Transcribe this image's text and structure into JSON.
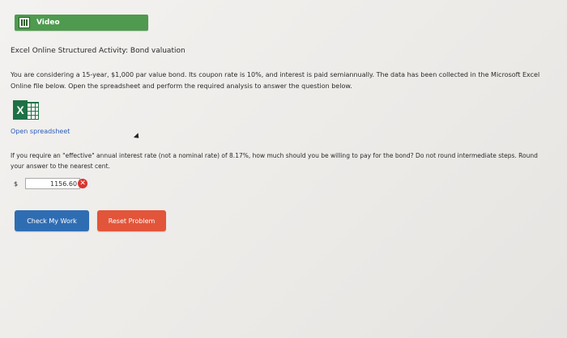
{
  "video": {
    "label": "Video"
  },
  "title": "Excel Online Structured Activity: Bond valuation",
  "description": "You are considering a 15-year, $1,000 par value bond. Its coupon rate is 10%, and interest is paid semiannually. The data has been collected in the Microsoft Excel Online file below. Open the spreadsheet and perform the required analysis to answer the question below.",
  "excel_icon_letter": "X",
  "open_spreadsheet": "Open spreadsheet",
  "question": "If you require an \"effective\" annual interest rate (not a nominal rate) of 8.17%, how much should you be willing to pay for the bond? Do not round intermediate steps. Round your answer to the nearest cent.",
  "answer": {
    "currency": "$",
    "value": "1156.60",
    "status_icon": "x-circle-icon"
  },
  "buttons": {
    "check": "Check My Work",
    "reset": "Reset Problem"
  },
  "colors": {
    "video_bar": "#4f9a4f",
    "check_button": "#2f6db3",
    "reset_button": "#e2553a",
    "excel": "#1e7145",
    "error": "#d9352f",
    "link": "#2a5bb8"
  }
}
